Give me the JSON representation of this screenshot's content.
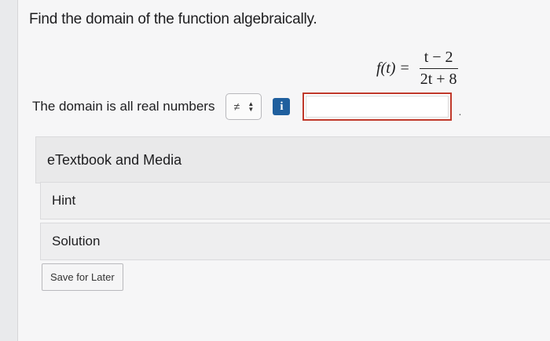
{
  "question": {
    "prompt": "Find the domain of the function algebraically.",
    "formula": {
      "lhs": "f(t)",
      "equals": "=",
      "numerator": "t − 2",
      "denominator": "2t + 8"
    }
  },
  "answer": {
    "label": "The domain is all real numbers",
    "operator_selected": "≠",
    "operator_arrows": "▲▼",
    "info_icon_text": "i",
    "input_value": "",
    "trailing_period": "."
  },
  "resources": {
    "items": [
      {
        "label": "eTextbook and Media"
      },
      {
        "label": "Hint"
      },
      {
        "label": "Solution"
      }
    ]
  },
  "actions": {
    "save_for_later": "Save for Later"
  },
  "colors": {
    "accent": "#1f5f9e",
    "input_border_error": "#c0392b"
  }
}
